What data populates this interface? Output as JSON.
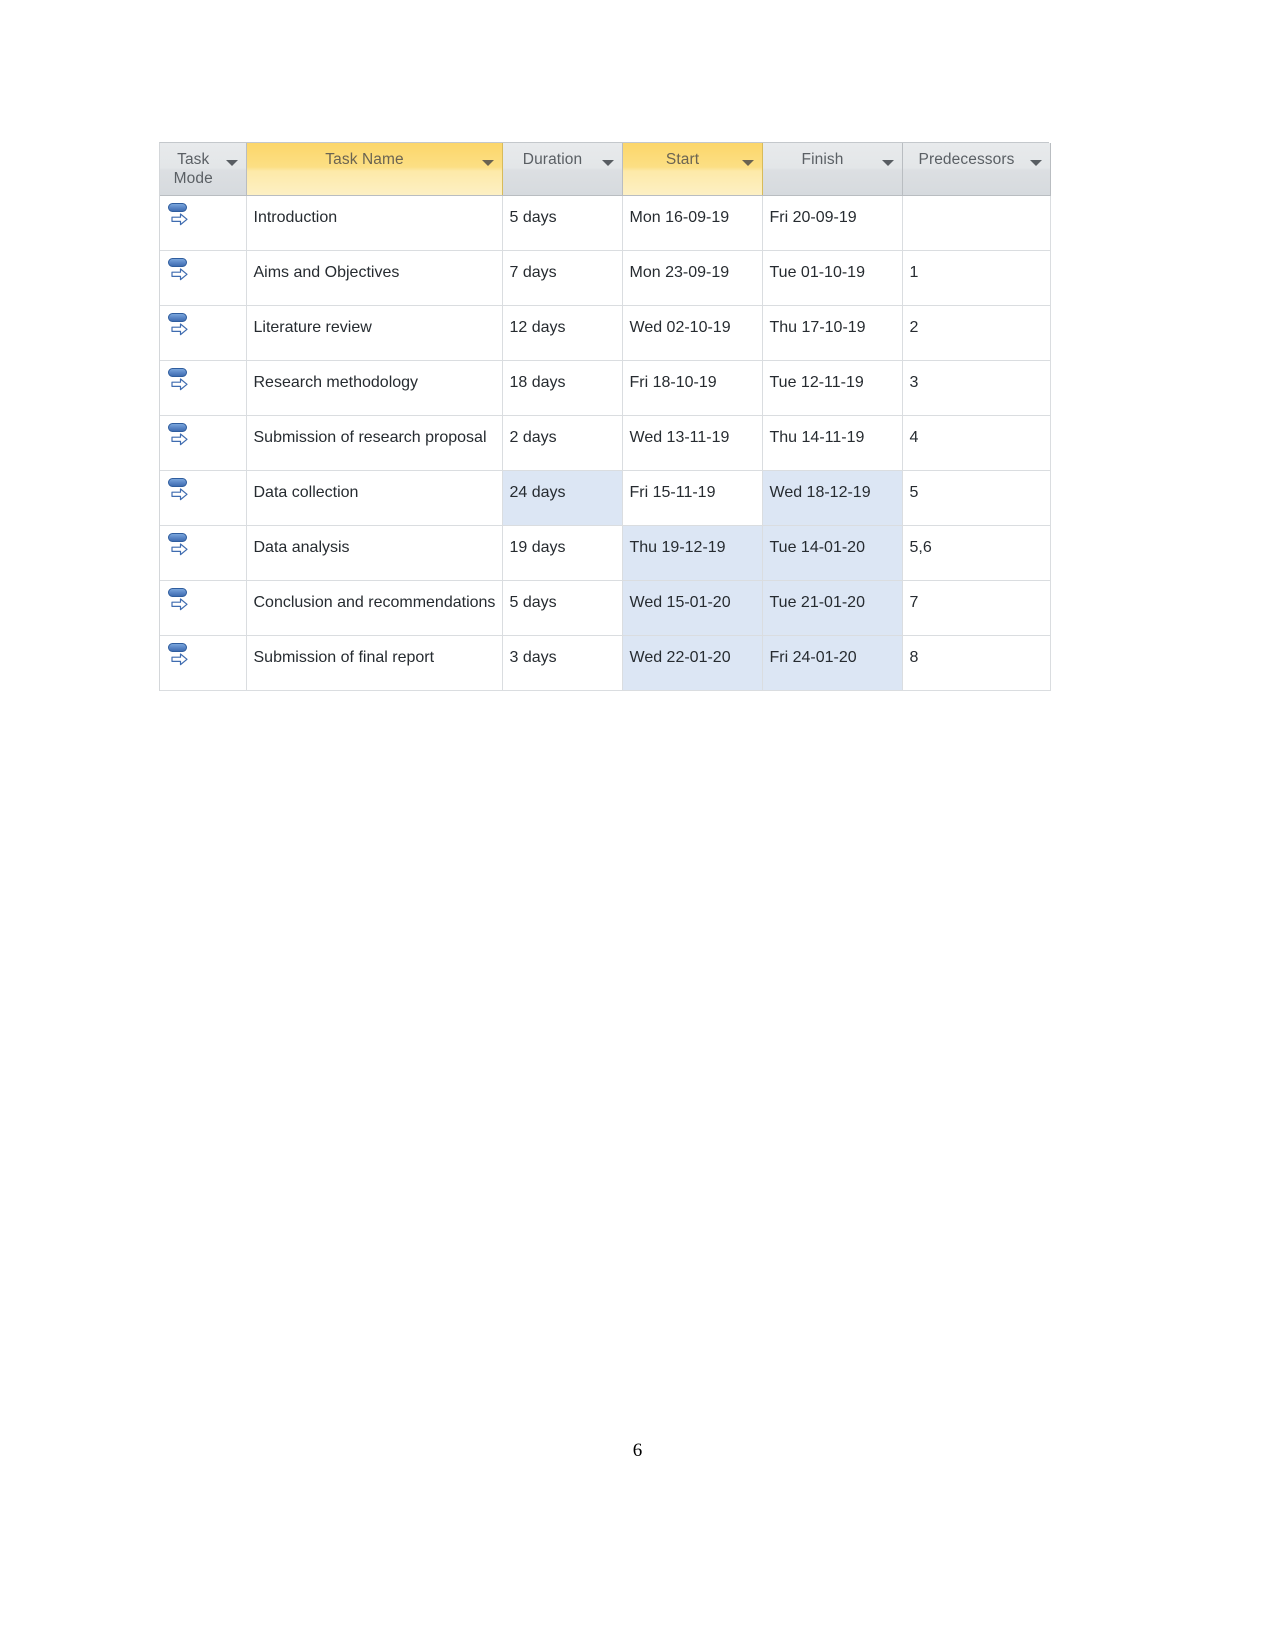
{
  "document": {
    "page_number": "6"
  },
  "table": {
    "name": "project-schedule-table",
    "columns": [
      {
        "key": "task_mode",
        "label": "Task Mode",
        "highlighted": false,
        "has_filter": true
      },
      {
        "key": "task_name",
        "label": "Task Name",
        "highlighted": true,
        "has_filter": true
      },
      {
        "key": "duration",
        "label": "Duration",
        "highlighted": false,
        "has_filter": true
      },
      {
        "key": "start",
        "label": "Start",
        "highlighted": true,
        "has_filter": true
      },
      {
        "key": "finish",
        "label": "Finish",
        "highlighted": false,
        "has_filter": true
      },
      {
        "key": "predecessors",
        "label": "Predecessors",
        "highlighted": false,
        "has_filter": true
      }
    ],
    "rows": [
      {
        "task_mode_icon": "auto-scheduled-icon",
        "task_name": "Introduction",
        "duration": "5 days",
        "start": "Mon 16-09-19",
        "finish": "Fri 20-09-19",
        "predecessors": "",
        "selected": {
          "duration": false,
          "start": false,
          "finish": false
        }
      },
      {
        "task_mode_icon": "auto-scheduled-icon",
        "task_name": "Aims and Objectives",
        "duration": "7 days",
        "start": "Mon 23-09-19",
        "finish": "Tue 01-10-19",
        "predecessors": "1",
        "selected": {
          "duration": false,
          "start": false,
          "finish": false
        }
      },
      {
        "task_mode_icon": "auto-scheduled-icon",
        "task_name": "Literature review",
        "duration": "12 days",
        "start": "Wed 02-10-19",
        "finish": "Thu 17-10-19",
        "predecessors": "2",
        "selected": {
          "duration": false,
          "start": false,
          "finish": false
        }
      },
      {
        "task_mode_icon": "auto-scheduled-icon",
        "task_name": "Research methodology",
        "duration": "18 days",
        "start": "Fri 18-10-19",
        "finish": "Tue 12-11-19",
        "predecessors": "3",
        "selected": {
          "duration": false,
          "start": false,
          "finish": false
        }
      },
      {
        "task_mode_icon": "auto-scheduled-icon",
        "task_name": "Submission of research proposal",
        "duration": "2 days",
        "start": "Wed 13-11-19",
        "finish": "Thu 14-11-19",
        "predecessors": "4",
        "selected": {
          "duration": false,
          "start": false,
          "finish": false
        }
      },
      {
        "task_mode_icon": "auto-scheduled-icon",
        "task_name": "Data collection",
        "duration": "24 days",
        "start": "Fri 15-11-19",
        "finish": "Wed 18-12-19",
        "predecessors": "5",
        "selected": {
          "duration": true,
          "start": false,
          "finish": true
        }
      },
      {
        "task_mode_icon": "auto-scheduled-icon",
        "task_name": "Data analysis",
        "duration": "19 days",
        "start": "Thu 19-12-19",
        "finish": "Tue 14-01-20",
        "predecessors": "5,6",
        "selected": {
          "duration": false,
          "start": true,
          "finish": true
        }
      },
      {
        "task_mode_icon": "auto-scheduled-icon",
        "task_name": "Conclusion and recommendations",
        "duration": "5 days",
        "start": "Wed 15-01-20",
        "finish": "Tue 21-01-20",
        "predecessors": "7",
        "selected": {
          "duration": false,
          "start": true,
          "finish": true
        }
      },
      {
        "task_mode_icon": "auto-scheduled-icon",
        "task_name": "Submission of final report",
        "duration": "3 days",
        "start": "Wed 22-01-20",
        "finish": "Fri 24-01-20",
        "predecessors": "8",
        "selected": {
          "duration": false,
          "start": true,
          "finish": true
        }
      }
    ]
  },
  "colors": {
    "header_highlight": "#fcd66a",
    "header_default": "#e3e6e8",
    "cell_selection": "#dce6f4",
    "icon_blue": "#3f6cb0",
    "grid_line": "#dadde0"
  }
}
